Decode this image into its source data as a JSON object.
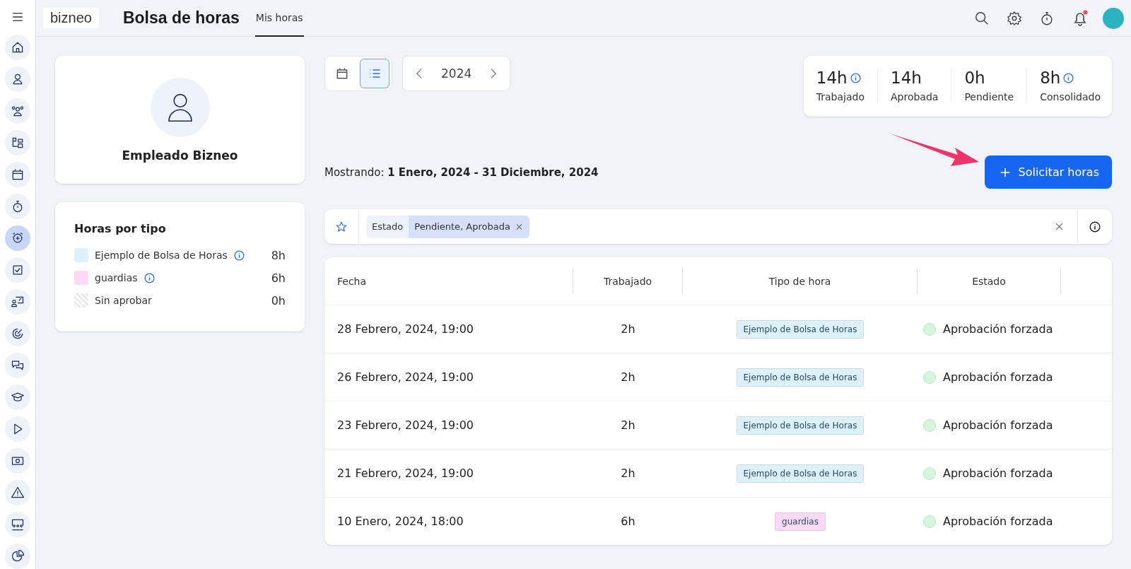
{
  "sidebar": {
    "items": [
      {
        "kind": "home",
        "selected": false
      },
      {
        "kind": "person",
        "selected": false
      },
      {
        "kind": "people",
        "selected": false
      },
      {
        "kind": "org",
        "selected": false
      },
      {
        "kind": "calendar",
        "selected": false
      },
      {
        "kind": "stopwatch",
        "selected": false
      },
      {
        "kind": "alarm",
        "selected": true
      },
      {
        "kind": "check",
        "selected": false
      },
      {
        "kind": "presentation",
        "selected": false
      },
      {
        "kind": "target",
        "selected": false
      },
      {
        "kind": "chat",
        "selected": false
      },
      {
        "kind": "cap",
        "selected": false
      },
      {
        "kind": "play",
        "selected": false
      },
      {
        "kind": "money",
        "selected": false
      },
      {
        "kind": "warning",
        "selected": false
      },
      {
        "kind": "meeting",
        "selected": false
      },
      {
        "kind": "pie",
        "selected": false
      }
    ]
  },
  "header": {
    "logo": "bizneo",
    "title": "Bolsa de horas",
    "tabs": [
      {
        "label": "Mis horas",
        "selected": true
      }
    ]
  },
  "profile": {
    "name": "Empleado Bizneo"
  },
  "hours_by_type": {
    "title": "Horas por tipo",
    "items": [
      {
        "kind": "solid",
        "color": "#dcf1fb",
        "label": "Ejemplo de Bolsa de Horas",
        "info": true,
        "value": "8h"
      },
      {
        "kind": "solid",
        "color": "#fbdaf7",
        "label": "guardias",
        "info": true,
        "value": "6h"
      },
      {
        "kind": "hatched",
        "label": "Sin aprobar",
        "info": false,
        "value": "0h"
      }
    ]
  },
  "view_toggle": [
    {
      "kind": "calendar",
      "selected": false
    },
    {
      "kind": "list",
      "selected": true
    }
  ],
  "year_picker": {
    "value": "2024"
  },
  "stats": [
    {
      "value": "14h",
      "label": "Trabajado",
      "info": true
    },
    {
      "value": "14h",
      "label": "Aprobada",
      "info": false
    },
    {
      "value": "0h",
      "label": "Pendiente",
      "info": false
    },
    {
      "value": "8h",
      "label": "Consolidado",
      "info": true
    }
  ],
  "range": {
    "label": "Mostrando:",
    "value": "1 Enero, 2024 - 31 Diciembre, 2024"
  },
  "request_button": {
    "label": "Solicitar horas"
  },
  "filter": {
    "field": "Estado",
    "value": "Pendiente, Aprobada"
  },
  "table": {
    "columns": [
      "Fecha",
      "Trabajado",
      "Tipo de hora",
      "Estado"
    ],
    "rows": [
      {
        "date": "28 Febrero, 2024, 19:00",
        "worked": "2h",
        "type": {
          "label": "Ejemplo de Bolsa de Horas",
          "color": "#dcf1fb"
        },
        "status": {
          "label": "Aprobación forzada",
          "color": "#d6f5dc"
        }
      },
      {
        "date": "26 Febrero, 2024, 19:00",
        "worked": "2h",
        "type": {
          "label": "Ejemplo de Bolsa de Horas",
          "color": "#dcf1fb"
        },
        "status": {
          "label": "Aprobación forzada",
          "color": "#d6f5dc"
        }
      },
      {
        "date": "23 Febrero, 2024, 19:00",
        "worked": "2h",
        "type": {
          "label": "Ejemplo de Bolsa de Horas",
          "color": "#dcf1fb"
        },
        "status": {
          "label": "Aprobación forzada",
          "color": "#d6f5dc"
        }
      },
      {
        "date": "21 Febrero, 2024, 19:00",
        "worked": "2h",
        "type": {
          "label": "Ejemplo de Bolsa de Horas",
          "color": "#dcf1fb"
        },
        "status": {
          "label": "Aprobación forzada",
          "color": "#d6f5dc"
        }
      },
      {
        "date": "10 Enero, 2024, 18:00",
        "worked": "6h",
        "type": {
          "label": "guardias",
          "color": "#fbdaf7"
        },
        "status": {
          "label": "Aprobación forzada",
          "color": "#d6f5dc"
        }
      }
    ]
  }
}
